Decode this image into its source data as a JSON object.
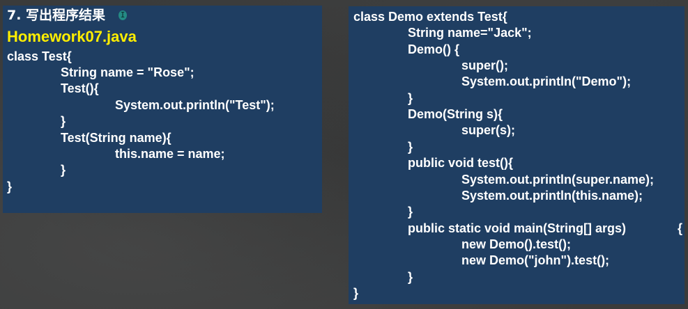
{
  "slide": {
    "title": "7. 写出程序结果",
    "file_name": "Homework07.java"
  },
  "left_code": {
    "lines": [
      "class Test{",
      "String name = \"Rose\";",
      "Test(){",
      "System.out.println(\"Test\");",
      "}",
      "Test(String name){",
      "this.name = name;",
      "}",
      "}"
    ]
  },
  "right_code": {
    "lines": [
      "class Demo extends Test{",
      "String name=\"Jack\";",
      "Demo() {",
      "super();",
      "System.out.println(\"Demo\");",
      "}",
      "Demo(String s){",
      "super(s);",
      "}",
      "public void test(){",
      "System.out.println(super.name);",
      "System.out.println(this.name);",
      "}",
      "public static void main(String[] args)",
      "{",
      "new Demo().test();",
      "new Demo(\"john\").test();",
      "}",
      "}"
    ]
  },
  "cursor": {
    "glyph": "I"
  },
  "colors": {
    "background": "#3a3b3b",
    "panel": "#1f3e62",
    "code_text": "#ffffff",
    "file_name": "#ffee00"
  }
}
